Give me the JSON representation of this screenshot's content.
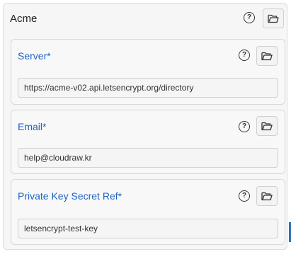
{
  "section": {
    "title": "Acme"
  },
  "fields": [
    {
      "label": "Server*",
      "value": "https://acme-v02.api.letsencrypt.org/directory"
    },
    {
      "label": "Email*",
      "value": "help@cloudraw.kr"
    },
    {
      "label": "Private Key Secret Ref*",
      "value": "letsencrypt-test-key"
    }
  ],
  "icons": {
    "help": "?",
    "help_name": "help-circle-icon",
    "folder_name": "folder-open-icon"
  },
  "colors": {
    "label": "#1c64c4",
    "accent": "#2a6ebf"
  }
}
